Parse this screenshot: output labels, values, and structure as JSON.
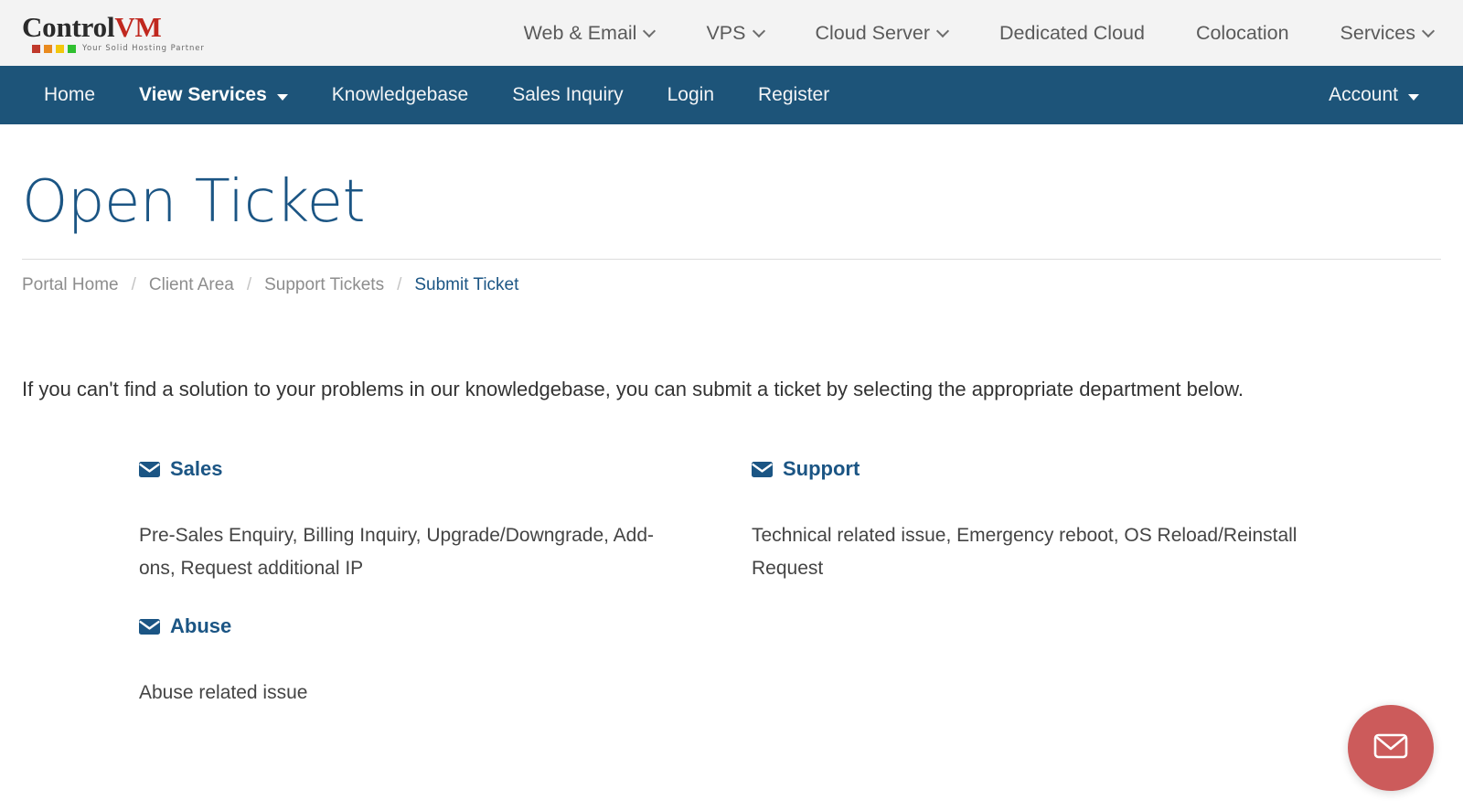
{
  "header": {
    "logo": {
      "name_primary": "Control",
      "name_accent": "VM",
      "tagline": "Your Solid Hosting Partner",
      "swatches": [
        "#c0392b",
        "#e98a1f",
        "#f2c70d",
        "#30c030"
      ]
    },
    "nav": [
      {
        "label": "Web & Email",
        "has_dropdown": true
      },
      {
        "label": "VPS",
        "has_dropdown": true
      },
      {
        "label": "Cloud Server",
        "has_dropdown": true
      },
      {
        "label": "Dedicated Cloud",
        "has_dropdown": false
      },
      {
        "label": "Colocation",
        "has_dropdown": false
      },
      {
        "label": "Services",
        "has_dropdown": true
      }
    ]
  },
  "primary_nav": {
    "background": "#1d5479",
    "left_items": [
      {
        "label": "Home",
        "active": false,
        "has_dropdown": false
      },
      {
        "label": "View Services",
        "active": true,
        "has_dropdown": true
      },
      {
        "label": "Knowledgebase",
        "active": false,
        "has_dropdown": false
      },
      {
        "label": "Sales Inquiry",
        "active": false,
        "has_dropdown": false
      },
      {
        "label": "Login",
        "active": false,
        "has_dropdown": false
      },
      {
        "label": "Register",
        "active": false,
        "has_dropdown": false
      }
    ],
    "right_items": [
      {
        "label": "Account",
        "active": false,
        "has_dropdown": true
      }
    ]
  },
  "page": {
    "title": "Open Ticket",
    "title_color": "#1b5584",
    "breadcrumb": [
      {
        "label": "Portal Home",
        "current": false
      },
      {
        "label": "Client Area",
        "current": false
      },
      {
        "label": "Support Tickets",
        "current": false
      },
      {
        "label": "Submit Ticket",
        "current": true
      }
    ],
    "breadcrumb_separator": "/",
    "intro": "If you can't find a solution to your problems in our knowledgebase, you can submit a ticket by selecting the appropriate department below."
  },
  "departments": [
    {
      "name": "Sales",
      "icon": "envelope-icon",
      "description": "Pre-Sales Enquiry, Billing Inquiry, Upgrade/Downgrade, Add-ons, Request additional IP"
    },
    {
      "name": "Support",
      "icon": "envelope-icon",
      "description": "Technical related issue, Emergency reboot, OS Reload/Reinstall Request"
    },
    {
      "name": "Abuse",
      "icon": "envelope-icon",
      "description": "Abuse related issue"
    }
  ],
  "floating_button": {
    "icon": "envelope-icon",
    "color": "#cc5b5b"
  }
}
